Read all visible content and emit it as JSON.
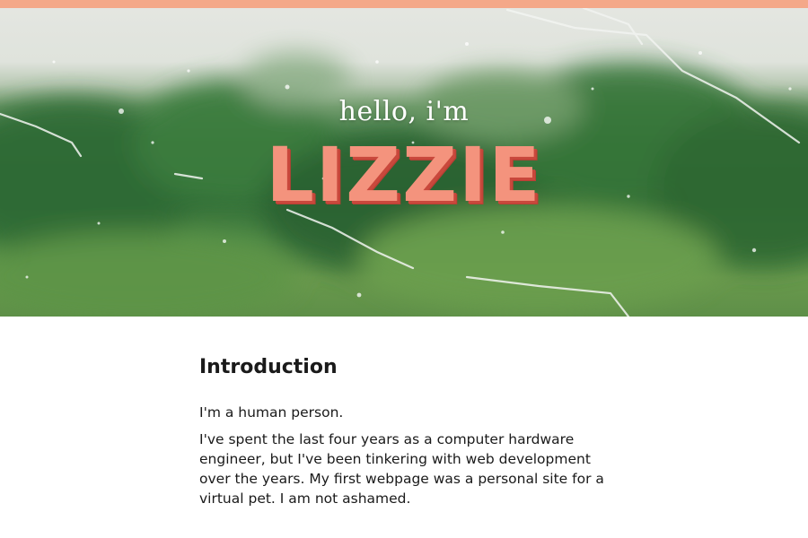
{
  "accent_color": "#f4a889",
  "hero": {
    "greeting": "hello, i'm",
    "name": "LIZZIE",
    "background": "rain-on-window-greenery"
  },
  "intro": {
    "heading": "Introduction",
    "paragraphs": [
      "I'm a human person.",
      "I've spent the last four years as a computer hardware engineer, but I've been tinkering with web development over the years. My first webpage was a personal site for a virtual pet. I am not ashamed."
    ]
  }
}
